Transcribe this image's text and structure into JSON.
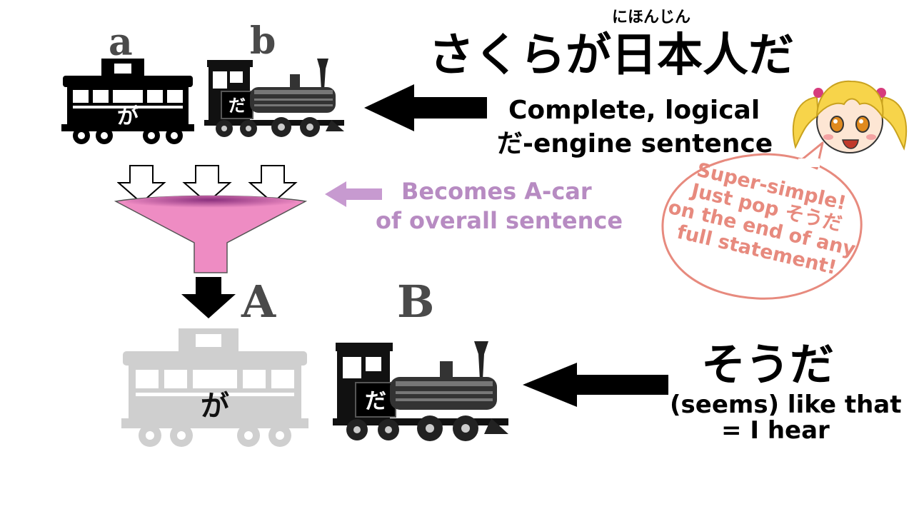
{
  "top": {
    "car_a_label": "a",
    "car_b_label": "b",
    "car_a_particle": "が",
    "car_b_particle": "だ",
    "furigana": "にほんじん",
    "sentence": "さくらが日本人だ",
    "desc_line1": "Complete, logical",
    "desc_line2": "だ-engine sentence"
  },
  "funnel": {
    "desc_line1": "Becomes A-car",
    "desc_line2": "of overall sentence",
    "fill_color": "#ee8cc3",
    "inner_color": "#8a2f7d"
  },
  "bottom": {
    "car_a_label": "A",
    "car_b_label": "B",
    "car_a_particle": "が",
    "car_b_particle": "だ",
    "word": "そうだ",
    "meaning_line1": "(seems) like that",
    "meaning_line2": "= I hear"
  },
  "bubble": {
    "line1": "Super-simple!",
    "line2_a": "Just pop ",
    "line2_b": "そうだ",
    "line3": "on the end of any",
    "line4": "full statement!",
    "color": "#e78a7e"
  },
  "colors": {
    "arrow_purple": "#c79ad0",
    "letter_gray": "#4a4a4a",
    "faded_car": "#cfcfcf"
  },
  "icons": [
    "caboose-car-icon",
    "steam-locomotive-icon",
    "funnel-icon",
    "down-arrow-icon",
    "left-arrow-icon",
    "cartoon-girl-icon",
    "speech-bubble-icon"
  ]
}
